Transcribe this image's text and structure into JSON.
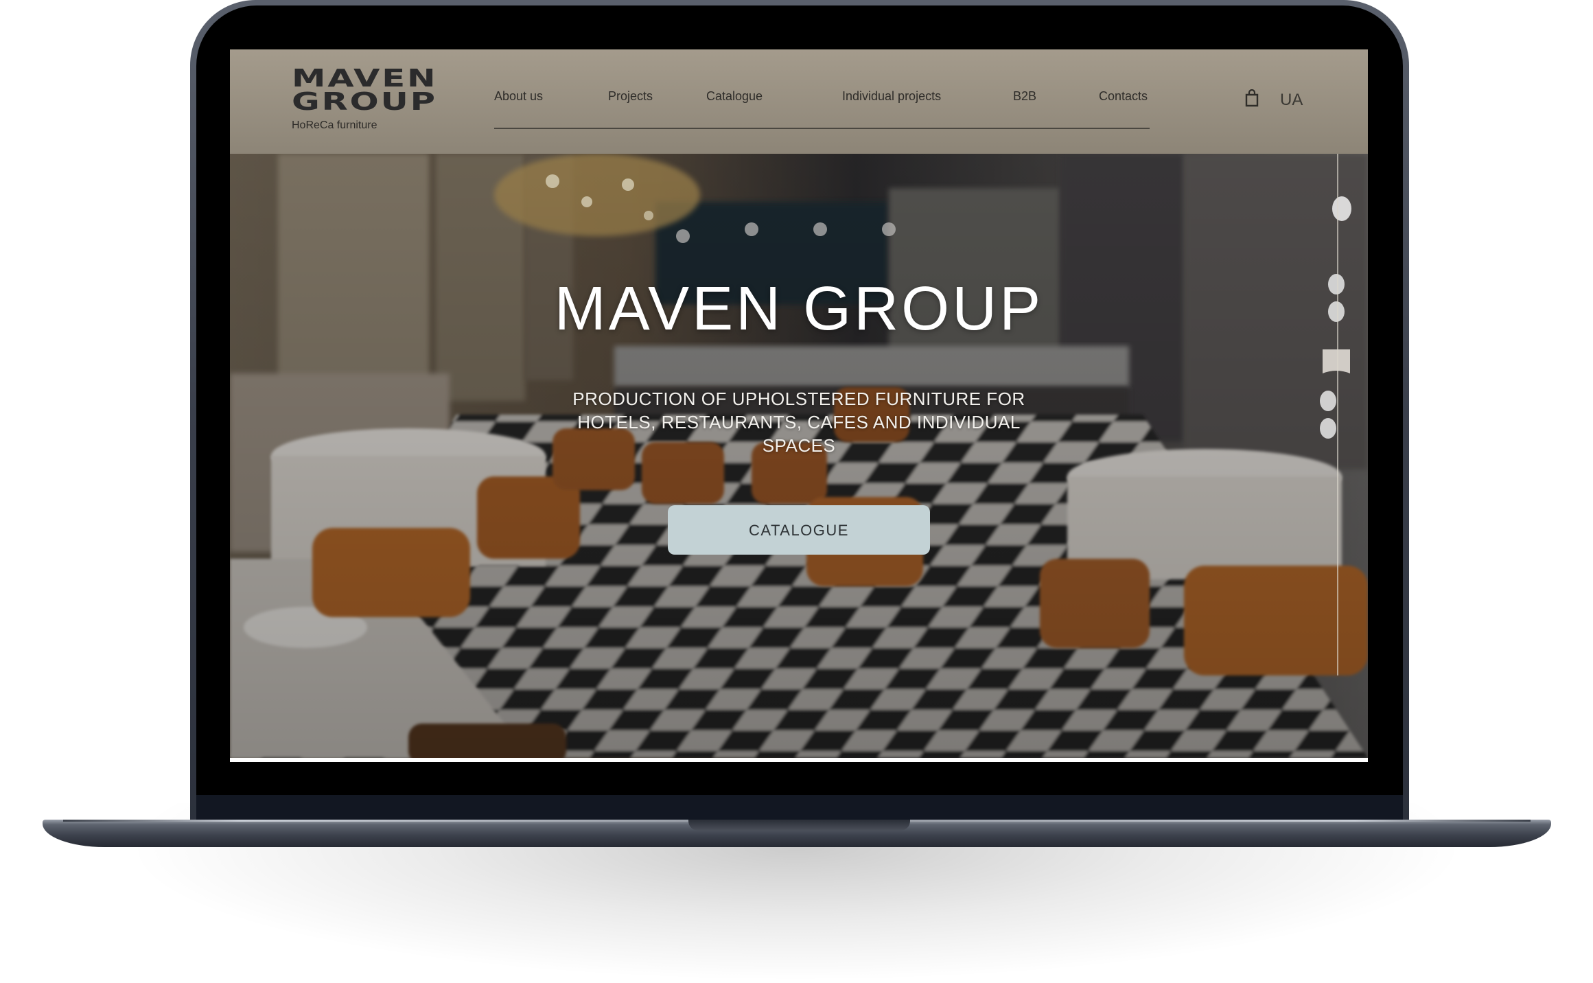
{
  "brand": {
    "logo_line1": "MAVEN",
    "logo_line2": "GROUP",
    "tagline": "HoReCa furniture"
  },
  "nav": {
    "items": [
      {
        "label": "About us"
      },
      {
        "label": "Projects"
      },
      {
        "label": "Catalogue"
      },
      {
        "label": "Individual projects"
      },
      {
        "label": "B2B"
      },
      {
        "label": "Contacts"
      }
    ]
  },
  "header_actions": {
    "cart_icon": "shopping-bag-icon",
    "language": "UA"
  },
  "hero": {
    "title": "MAVEN GROUP",
    "subtitle": "PRODUCTION OF UPHOLSTERED FURNITURE FOR HOTELS, RESTAURANTS, CAFES AND INDIVIDUAL SPACES",
    "cta_label": "CATALOGUE"
  },
  "colors": {
    "header_bg": "#9a9283",
    "cta_bg": "#c3d2d5",
    "device_frame": "#3a3f4b"
  }
}
